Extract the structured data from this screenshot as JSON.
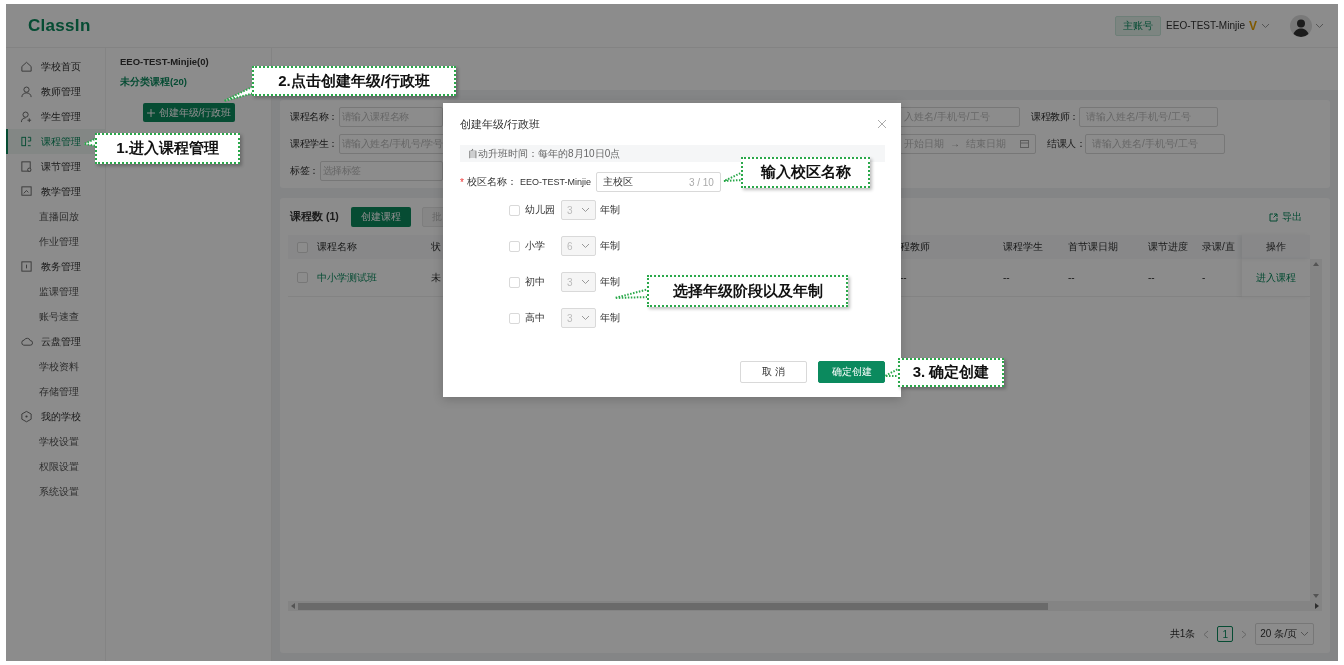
{
  "header": {
    "logo": "ClassIn",
    "account_badge": "主账号",
    "account_name": "EEO-TEST-Minjie",
    "vip_mark": "V"
  },
  "sidebar": {
    "items": [
      {
        "label": "学校首页",
        "kind": "group",
        "selected": false
      },
      {
        "label": "教师管理",
        "kind": "group",
        "selected": false
      },
      {
        "label": "学生管理",
        "kind": "group",
        "selected": false
      },
      {
        "label": "课程管理",
        "kind": "group",
        "selected": true
      },
      {
        "label": "课节管理",
        "kind": "group",
        "selected": false
      },
      {
        "label": "教学管理",
        "kind": "group",
        "selected": false
      },
      {
        "label": "直播回放",
        "kind": "sub",
        "selected": false
      },
      {
        "label": "作业管理",
        "kind": "sub",
        "selected": false
      },
      {
        "label": "教务管理",
        "kind": "group",
        "selected": false
      },
      {
        "label": "监课管理",
        "kind": "sub",
        "selected": false
      },
      {
        "label": "账号速查",
        "kind": "sub",
        "selected": false
      },
      {
        "label": "云盘管理",
        "kind": "group",
        "selected": false
      },
      {
        "label": "学校资料",
        "kind": "sub",
        "selected": false
      },
      {
        "label": "存储管理",
        "kind": "sub",
        "selected": false
      },
      {
        "label": "我的学校",
        "kind": "group",
        "selected": false
      },
      {
        "label": "学校设置",
        "kind": "sub",
        "selected": false
      },
      {
        "label": "权限设置",
        "kind": "sub",
        "selected": false
      },
      {
        "label": "系统设置",
        "kind": "sub",
        "selected": false
      }
    ]
  },
  "org_panel": {
    "title": "EEO-TEST-Minjie(0)",
    "items": [
      {
        "label": "未分类课程(20)",
        "selected": true
      }
    ],
    "create_button": "创建年级/行政班"
  },
  "filters": {
    "rows": [
      {
        "left": {
          "label": "课程名称：",
          "placeholder": "请输入课程名称"
        },
        "right": [
          {
            "kind": "field",
            "placeholder": "入姓名/手机号/工号"
          },
          {
            "kind": "field",
            "label": "课程教师：",
            "placeholder": "请输入姓名/手机号/工号"
          }
        ]
      },
      {
        "left": {
          "label": "课程学生：",
          "placeholder": "请输入姓名/手机号/学号"
        },
        "right": [
          {
            "kind": "date_range",
            "start": "开始日期",
            "separator": "→",
            "end": "结束日期"
          },
          {
            "kind": "field",
            "label": "结课人：",
            "placeholder": "请输入姓名/手机号/工号"
          }
        ]
      },
      {
        "left": {
          "label": "标签：",
          "placeholder": "选择标签"
        }
      }
    ]
  },
  "table": {
    "count_label": "课程数 (1)",
    "create_button": "创建课程",
    "batch_button": {
      "label": "批",
      "disabled": true
    },
    "export": "导出",
    "select_all": {
      "checked": false
    },
    "columns": [
      {
        "label": "课程名称"
      },
      {
        "label": "状"
      },
      {
        "label": "程教师"
      },
      {
        "label": "课程学生"
      },
      {
        "label": "首节课日期"
      },
      {
        "label": "课节进度"
      },
      {
        "label": "录课/直"
      },
      {
        "label": "操作"
      }
    ],
    "rows": [
      {
        "checked": false,
        "cells": [
          "中小学测试班",
          "未",
          "--",
          "--",
          "--",
          "--",
          "-"
        ],
        "action": "进入课程"
      }
    ]
  },
  "pagination": {
    "total": "共1条",
    "pages": [
      {
        "label": "1",
        "selected": true
      }
    ],
    "page_size": "20 条/页"
  },
  "dialog": {
    "title": "创建年级/行政班",
    "notice": "自动升班时间：每年的8月10日0点",
    "campus": {
      "required_mark": "*",
      "label": "校区名称：",
      "prefix": "EEO-TEST-Minjie",
      "value": "主校区",
      "counter": "3 / 10"
    },
    "stages": [
      {
        "label": "幼儿园",
        "checked": false,
        "years": "3",
        "unit": "年制"
      },
      {
        "label": "小学",
        "checked": false,
        "years": "6",
        "unit": "年制"
      },
      {
        "label": "初中",
        "checked": false,
        "years": "3",
        "unit": "年制"
      },
      {
        "label": "高中",
        "checked": false,
        "years": "3",
        "unit": "年制"
      }
    ],
    "cancel": "取 消",
    "confirm": "确定创建"
  },
  "annotations": [
    {
      "text": "2.点击创建年级/行政班"
    },
    {
      "text": "1.进入课程管理"
    },
    {
      "text": "输入校区名称"
    },
    {
      "text": "选择年级阶段以及年制"
    },
    {
      "text": "3. 确定创建"
    }
  ]
}
